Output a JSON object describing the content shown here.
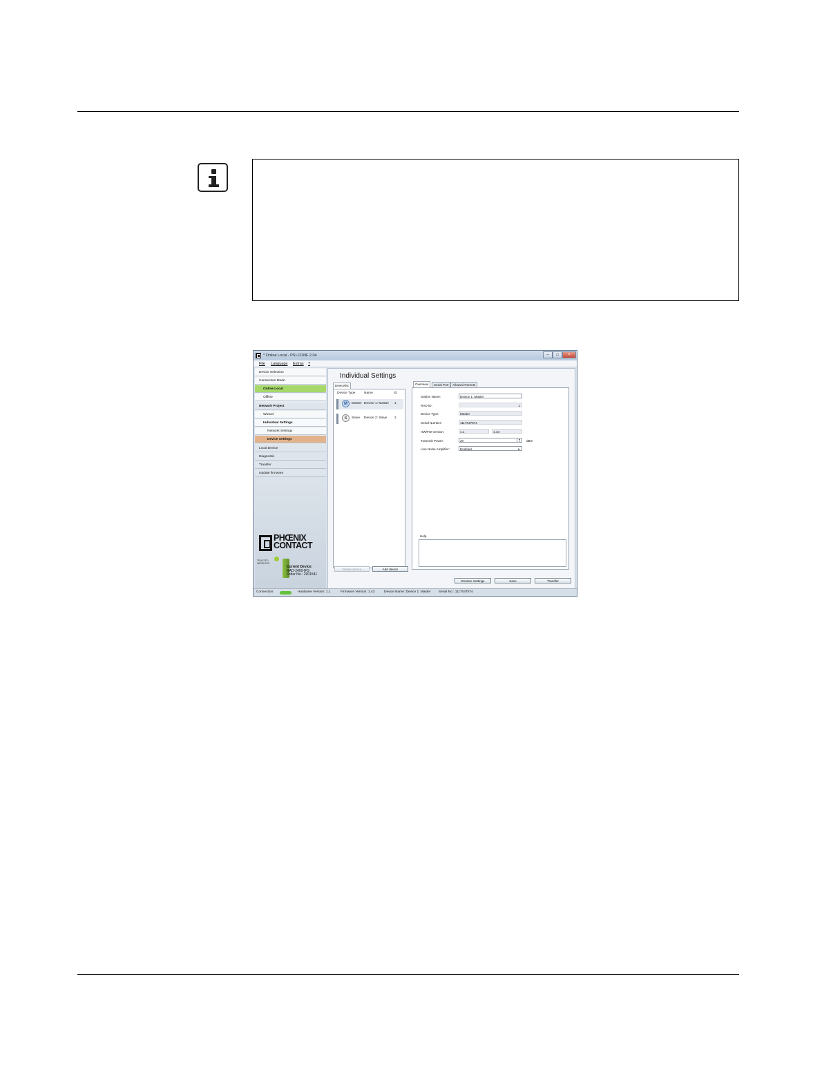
{
  "window": {
    "title": "* Online Local - PSI-CONF 2.04"
  },
  "menu": [
    "File",
    "Language",
    "Extras",
    "?"
  ],
  "sidebar": {
    "items": [
      {
        "label": "Device Selection"
      },
      {
        "label": "Connection Mode"
      },
      {
        "label": "Online Local"
      },
      {
        "label": "Offline"
      },
      {
        "label": "Network Project"
      },
      {
        "label": "Wizard"
      },
      {
        "label": "Individual Settings"
      },
      {
        "label": "Network Settings"
      },
      {
        "label": "Device Settings"
      },
      {
        "label": "Local Device"
      },
      {
        "label": "Diagnostic"
      },
      {
        "label": "Transfer"
      },
      {
        "label": "Update firmware"
      }
    ],
    "brand_line1": "PHŒNIX",
    "brand_line2": "CONTACT",
    "trusted_line1": "TRUSTED",
    "trusted_line2": "WIRELESS",
    "current_device_heading": "Current Device:",
    "current_device_model": "RAD-2400-IFS",
    "current_device_order": "Order No.: 2901541"
  },
  "panel": {
    "title": "Individual Settings",
    "devicelist_tab": "Devicelist",
    "columns": {
      "type": "Device Type",
      "name": "Name",
      "id": "ID"
    },
    "devices": [
      {
        "badge": "M",
        "type": "Master",
        "name": "Device 1: Master",
        "id": "1"
      },
      {
        "badge": "S",
        "type": "Slave",
        "name": "Device 2: Slave",
        "id": "2"
      }
    ],
    "delete_button": "Delete device",
    "add_button": "Add device"
  },
  "detail": {
    "tabs": [
      "Overview",
      "Serial Port",
      "Allowed Parents"
    ],
    "fields": {
      "station_name": {
        "label": "Station Name:",
        "value": "Device 1: Master"
      },
      "rad_id": {
        "label": "RAD ID:",
        "value": "1"
      },
      "device_type": {
        "label": "Device Type:",
        "value": "Master"
      },
      "serial_number": {
        "label": "Serial Number:",
        "value": "1117047574"
      },
      "hw_fw": {
        "label": "HW/FW Version:",
        "hw": "1.1",
        "fw": "1.43"
      },
      "transmit_power": {
        "label": "Transmit Power:",
        "value": "20",
        "unit": "dBm"
      },
      "lna": {
        "label": "Line Noise Amplifier:",
        "value": "Enabled"
      }
    },
    "help_label": "Help"
  },
  "footer_buttons": {
    "restore": "Restore Settings",
    "save": "Save",
    "transfer": "Transfer"
  },
  "status": {
    "connection": "Connection:",
    "hardware": "Hardware Version: 1.1",
    "firmware": "Firmware Version: 1.43",
    "device_name": "Device Name: Device 1: Master",
    "serial": "Serial No.: 1117047574"
  }
}
